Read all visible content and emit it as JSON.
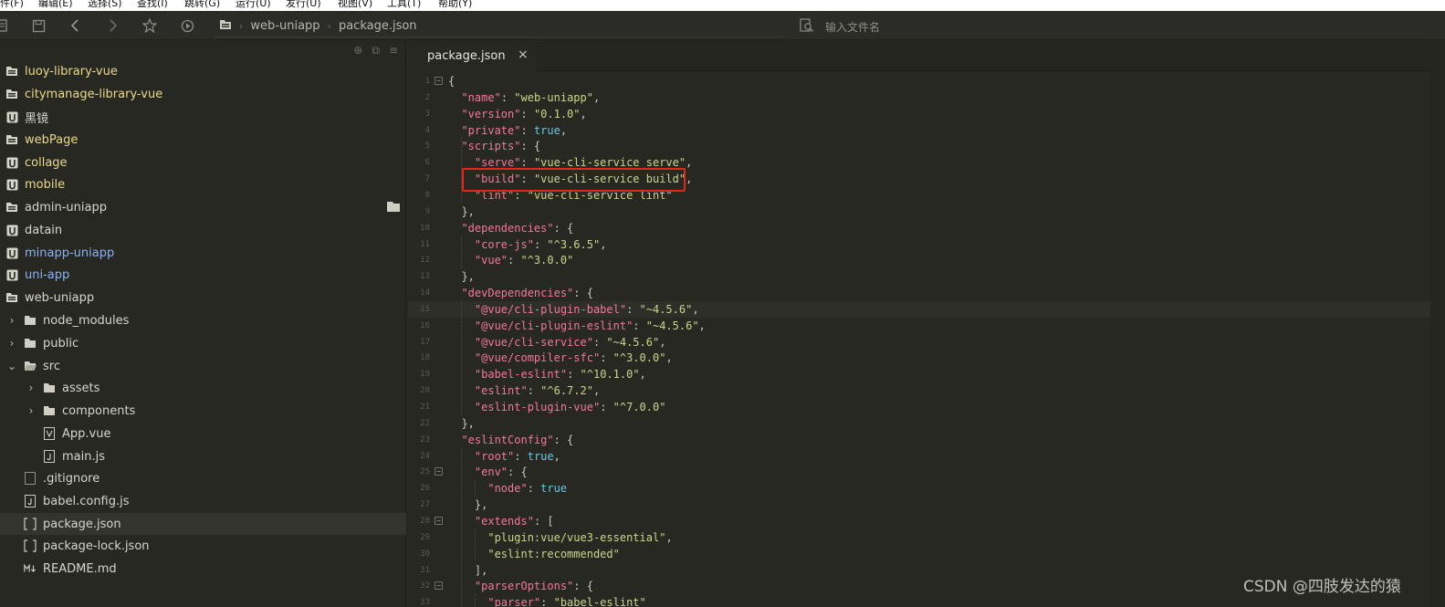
{
  "menubar": {
    "items": [
      "件(F)",
      "编辑(E)",
      "选择(S)",
      "查找(I)",
      "跳转(G)",
      "运行(U)",
      "发行(U)",
      "视图(V)",
      "工具(T)",
      "帮助(Y)"
    ]
  },
  "toolbar": {
    "breadcrumb": [
      "web-uniapp",
      "package.json"
    ],
    "search_placeholder": "输入文件名"
  },
  "sidebar": {
    "items": [
      {
        "label": "luoy-library-vue",
        "icon": "project-folder-icon",
        "color": "yellow"
      },
      {
        "label": "citymanage-library-vue",
        "icon": "project-folder-icon",
        "color": "yellow"
      },
      {
        "label": "黑镜",
        "icon": "uniapp-project-icon",
        "color": "default"
      },
      {
        "label": "webPage",
        "icon": "project-folder-icon",
        "color": "yellow"
      },
      {
        "label": "collage",
        "icon": "uniapp-project-icon",
        "color": "yellow"
      },
      {
        "label": "mobile",
        "icon": "uniapp-project-icon",
        "color": "yellow"
      },
      {
        "label": "admin-uniapp",
        "icon": "project-folder-icon",
        "color": "default"
      },
      {
        "label": "datain",
        "icon": "uniapp-project-icon",
        "color": "default"
      },
      {
        "label": "minapp-uniapp",
        "icon": "uniapp-project-icon",
        "color": "blue"
      },
      {
        "label": "uni-app",
        "icon": "uniapp-project-icon",
        "color": "blue"
      },
      {
        "label": "web-uniapp",
        "icon": "project-folder-icon",
        "color": "default"
      },
      {
        "label": "node_modules",
        "icon": "folder-icon",
        "color": "default"
      },
      {
        "label": "public",
        "icon": "folder-icon",
        "color": "default"
      },
      {
        "label": "src",
        "icon": "folder-open-icon",
        "color": "default"
      },
      {
        "label": "assets",
        "icon": "folder-icon",
        "color": "default"
      },
      {
        "label": "components",
        "icon": "folder-icon",
        "color": "default"
      },
      {
        "label": "App.vue",
        "icon": "vue-file-icon",
        "color": "default"
      },
      {
        "label": "main.js",
        "icon": "js-file-icon",
        "color": "default"
      },
      {
        "label": ".gitignore",
        "icon": "file-icon",
        "color": "default"
      },
      {
        "label": "babel.config.js",
        "icon": "js-file-icon",
        "color": "default"
      },
      {
        "label": "package.json",
        "icon": "json-file-icon",
        "color": "default"
      },
      {
        "label": "package-lock.json",
        "icon": "json-file-icon",
        "color": "default"
      },
      {
        "label": "README.md",
        "icon": "markdown-file-icon",
        "color": "default"
      }
    ]
  },
  "editor": {
    "tab_label": "package.json",
    "tab_close": "×",
    "lines": [
      [
        [
          "p",
          "{"
        ]
      ],
      [
        [
          "p",
          "  "
        ],
        [
          "k",
          "\"name\""
        ],
        [
          "p",
          ": "
        ],
        [
          "s",
          "\"web-uniapp\""
        ],
        [
          "p",
          ","
        ]
      ],
      [
        [
          "p",
          "  "
        ],
        [
          "k",
          "\"version\""
        ],
        [
          "p",
          ": "
        ],
        [
          "s",
          "\"0.1.0\""
        ],
        [
          "p",
          ","
        ]
      ],
      [
        [
          "p",
          "  "
        ],
        [
          "k",
          "\"private\""
        ],
        [
          "p",
          ": "
        ],
        [
          "b",
          "true"
        ],
        [
          "p",
          ","
        ]
      ],
      [
        [
          "p",
          "  "
        ],
        [
          "k",
          "\"scripts\""
        ],
        [
          "p",
          ": {"
        ]
      ],
      [
        [
          "p",
          "    "
        ],
        [
          "k",
          "\"serve\""
        ],
        [
          "p",
          ": "
        ],
        [
          "s",
          "\"vue-cli-service serve\""
        ],
        [
          "p",
          ","
        ]
      ],
      [
        [
          "p",
          "    "
        ],
        [
          "k",
          "\"build\""
        ],
        [
          "p",
          ": "
        ],
        [
          "s",
          "\"vue-cli-service build\""
        ],
        [
          "p",
          ","
        ]
      ],
      [
        [
          "p",
          "    "
        ],
        [
          "k",
          "\"lint\""
        ],
        [
          "p",
          ": "
        ],
        [
          "s",
          "\"vue-cli-service lint\""
        ]
      ],
      [
        [
          "p",
          "  },"
        ]
      ],
      [
        [
          "p",
          "  "
        ],
        [
          "k",
          "\"dependencies\""
        ],
        [
          "p",
          ": {"
        ]
      ],
      [
        [
          "p",
          "    "
        ],
        [
          "k",
          "\"core-js\""
        ],
        [
          "p",
          ": "
        ],
        [
          "s",
          "\"^3.6.5\""
        ],
        [
          "p",
          ","
        ]
      ],
      [
        [
          "p",
          "    "
        ],
        [
          "k",
          "\"vue\""
        ],
        [
          "p",
          ": "
        ],
        [
          "s",
          "\"^3.0.0\""
        ]
      ],
      [
        [
          "p",
          "  },"
        ]
      ],
      [
        [
          "p",
          "  "
        ],
        [
          "k",
          "\"devDependencies\""
        ],
        [
          "p",
          ": {"
        ]
      ],
      [
        [
          "p",
          "    "
        ],
        [
          "k",
          "\"@vue/cli-plugin-babel\""
        ],
        [
          "p",
          ": "
        ],
        [
          "s",
          "\"~4.5.6\""
        ],
        [
          "p",
          ","
        ]
      ],
      [
        [
          "p",
          "    "
        ],
        [
          "k",
          "\"@vue/cli-plugin-eslint\""
        ],
        [
          "p",
          ": "
        ],
        [
          "s",
          "\"~4.5.6\""
        ],
        [
          "p",
          ","
        ]
      ],
      [
        [
          "p",
          "    "
        ],
        [
          "k",
          "\"@vue/cli-service\""
        ],
        [
          "p",
          ": "
        ],
        [
          "s",
          "\"~4.5.6\""
        ],
        [
          "p",
          ","
        ]
      ],
      [
        [
          "p",
          "    "
        ],
        [
          "k",
          "\"@vue/compiler-sfc\""
        ],
        [
          "p",
          ": "
        ],
        [
          "s",
          "\"^3.0.0\""
        ],
        [
          "p",
          ","
        ]
      ],
      [
        [
          "p",
          "    "
        ],
        [
          "k",
          "\"babel-eslint\""
        ],
        [
          "p",
          ": "
        ],
        [
          "s",
          "\"^10.1.0\""
        ],
        [
          "p",
          ","
        ]
      ],
      [
        [
          "p",
          "    "
        ],
        [
          "k",
          "\"eslint\""
        ],
        [
          "p",
          ": "
        ],
        [
          "s",
          "\"^6.7.2\""
        ],
        [
          "p",
          ","
        ]
      ],
      [
        [
          "p",
          "    "
        ],
        [
          "k",
          "\"eslint-plugin-vue\""
        ],
        [
          "p",
          ": "
        ],
        [
          "s",
          "\"^7.0.0\""
        ]
      ],
      [
        [
          "p",
          "  },"
        ]
      ],
      [
        [
          "p",
          "  "
        ],
        [
          "k",
          "\"eslintConfig\""
        ],
        [
          "p",
          ": {"
        ]
      ],
      [
        [
          "p",
          "    "
        ],
        [
          "k",
          "\"root\""
        ],
        [
          "p",
          ": "
        ],
        [
          "b",
          "true"
        ],
        [
          "p",
          ","
        ]
      ],
      [
        [
          "p",
          "    "
        ],
        [
          "k",
          "\"env\""
        ],
        [
          "p",
          ": {"
        ]
      ],
      [
        [
          "p",
          "      "
        ],
        [
          "k",
          "\"node\""
        ],
        [
          "p",
          ": "
        ],
        [
          "b",
          "true"
        ]
      ],
      [
        [
          "p",
          "    },"
        ]
      ],
      [
        [
          "p",
          "    "
        ],
        [
          "k",
          "\"extends\""
        ],
        [
          "p",
          ": ["
        ]
      ],
      [
        [
          "p",
          "      "
        ],
        [
          "s",
          "\"plugin:vue/vue3-essential\""
        ],
        [
          "p",
          ","
        ]
      ],
      [
        [
          "p",
          "      "
        ],
        [
          "s",
          "\"eslint:recommended\""
        ]
      ],
      [
        [
          "p",
          "    ],"
        ]
      ],
      [
        [
          "p",
          "    "
        ],
        [
          "k",
          "\"parserOptions\""
        ],
        [
          "p",
          ": {"
        ]
      ],
      [
        [
          "p",
          "      "
        ],
        [
          "k",
          "\"parser\""
        ],
        [
          "p",
          ": "
        ],
        [
          "s",
          "\"babel-eslint\""
        ]
      ]
    ],
    "active_line": 15,
    "fold_lines": [
      1,
      25,
      28,
      32
    ]
  },
  "colors": {
    "background": "#272822",
    "key": "#f2789b",
    "string": "#c8d68a",
    "boolean": "#66c9e6",
    "highlight_box": "#e3271b"
  },
  "watermark": "CSDN @四肢发达的猿"
}
